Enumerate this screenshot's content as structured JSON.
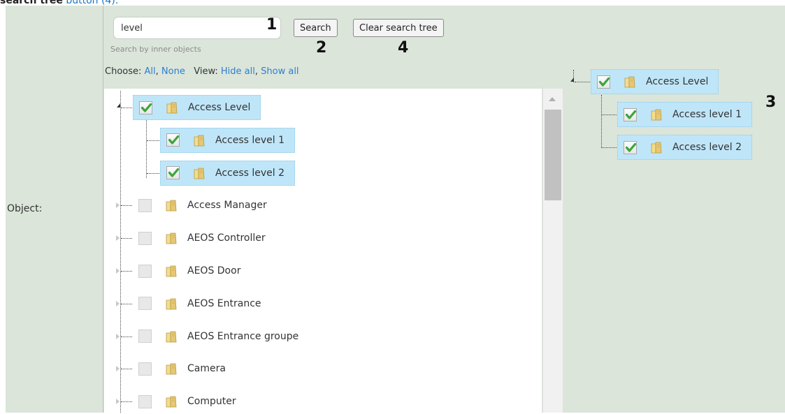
{
  "caption": {
    "bold_text": "search tree",
    "link_text": "button (4)."
  },
  "form": {
    "object_label": "Object:"
  },
  "search": {
    "value": "level",
    "hint": "Search by inner objects",
    "search_button": "Search",
    "clear_button": "Clear search tree"
  },
  "annotations": {
    "a1": "1",
    "a2": "2",
    "a3": "3",
    "a4": "4"
  },
  "toolbar": {
    "choose_label": "Choose:",
    "all": "All",
    "none": "None",
    "view_label": "View:",
    "hide_all": "Hide all",
    "show_all": "Show all"
  },
  "tree": {
    "items": [
      {
        "label": "Access Level",
        "checked": true,
        "selected": true,
        "level": 0,
        "expanded": true
      },
      {
        "label": "Access level 1",
        "checked": true,
        "selected": true,
        "level": 1
      },
      {
        "label": "Access level 2",
        "checked": true,
        "selected": true,
        "level": 1
      },
      {
        "label": "Access Manager",
        "checked": false,
        "selected": false,
        "level": 0
      },
      {
        "label": "AEOS Controller",
        "checked": false,
        "selected": false,
        "level": 0
      },
      {
        "label": "AEOS Door",
        "checked": false,
        "selected": false,
        "level": 0
      },
      {
        "label": "AEOS Entrance",
        "checked": false,
        "selected": false,
        "level": 0
      },
      {
        "label": "AEOS Entrance groupe",
        "checked": false,
        "selected": false,
        "level": 0
      },
      {
        "label": "Camera",
        "checked": false,
        "selected": false,
        "level": 0
      },
      {
        "label": "Computer",
        "checked": false,
        "selected": false,
        "level": 0
      }
    ]
  },
  "result_tree": {
    "items": [
      {
        "label": "Access Level",
        "checked": true,
        "level": 0
      },
      {
        "label": "Access level 1",
        "checked": true,
        "level": 1
      },
      {
        "label": "Access level 2",
        "checked": true,
        "level": 1
      }
    ]
  },
  "colors": {
    "panel_bg": "#dbe5da",
    "selected_bg": "#bfe6f8",
    "link": "#2d7fd0",
    "check_green": "#3aa63a",
    "folder": "#e6c874"
  },
  "icons": {
    "checkbox": "checkmark-icon",
    "folder": "folder-icon",
    "expand": "expander-triangle-icon"
  }
}
